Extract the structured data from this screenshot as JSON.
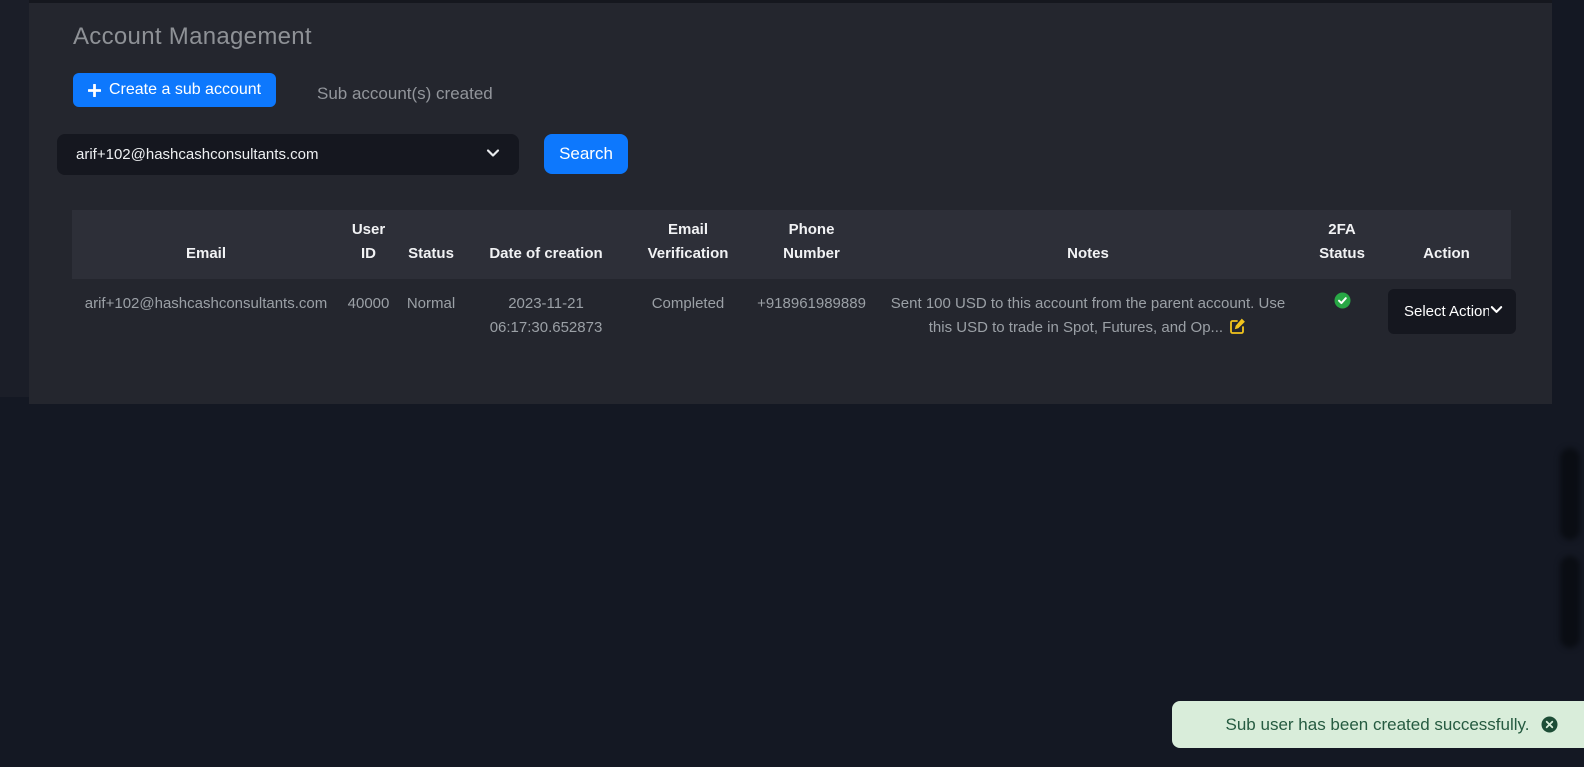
{
  "card": {
    "title": "Account Management",
    "create_button": {
      "label": "Create a sub account",
      "icon": "plus-icon"
    },
    "created_caption": "Sub account(s) created",
    "account_select": {
      "value": "arif+102@hashcashconsultants.com",
      "icon": "chevron-down-icon"
    },
    "search_button": {
      "label": "Search"
    }
  },
  "table": {
    "headers": {
      "email": "Email",
      "user_id": "User ID",
      "status": "Status",
      "date_of_creation": "Date of creation",
      "email_verification": "Email Verification",
      "phone_number": "Phone Number",
      "notes": "Notes",
      "twofa_status": "2FA Status",
      "action": "Action"
    },
    "row": {
      "email": "arif+102@hashcashconsultants.com",
      "user_id": "40000",
      "status": "Normal",
      "date_of_creation": "2023-11-21 06:17:30.652873",
      "email_verification": "Completed",
      "phone_number": "+918961989889",
      "notes": "Sent 100 USD to this account from the parent account. Use this USD to trade in Spot, Futures, and Op...",
      "notes_icon": "edit-icon",
      "twofa_status_icon": "check-circle-icon",
      "action_select": {
        "value": "Select Action",
        "icon": "chevron-down-icon"
      }
    }
  },
  "toast": {
    "message": "Sub user has been created successfully.",
    "close_icon": "close-circle-icon"
  },
  "colors": {
    "accent_blue": "#0d78fd",
    "success_green": "#28a745",
    "edit_icon_gold": "#f2c41d",
    "toast_bg": "#d9edda",
    "toast_text": "#265b41"
  }
}
